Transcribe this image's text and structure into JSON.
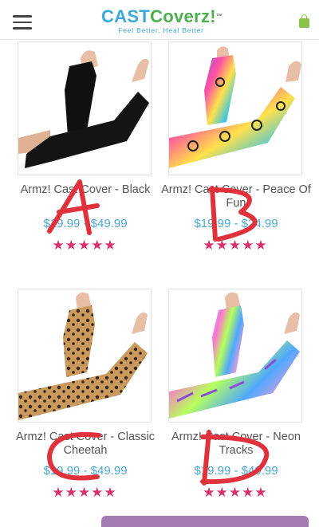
{
  "header": {
    "logo_cast": "CAST",
    "logo_coverz": "Coverz!",
    "logo_tm": "™",
    "tagline": "Feel Better, Heal Better"
  },
  "products": [
    {
      "title": "Armz! Cast Cover - Black",
      "price": "$19.99 - $49.99",
      "rating": 5,
      "stars": "★★★★★",
      "image": "black-arm-sleeves"
    },
    {
      "title": "Armz! Cast Cover - Peace Of Fun",
      "price": "$19.99 - $24.99",
      "rating": 5,
      "stars": "★★★★★",
      "image": "peace-pattern-arm-sleeves"
    },
    {
      "title": "Armz! Cast Cover - Classic Cheetah",
      "price": "$19.99 - $49.99",
      "rating": 5,
      "stars": "★★★★★",
      "image": "cheetah-arm-sleeves"
    },
    {
      "title": "Armz! Cast Cover - Neon Tracks",
      "price": "$19.99 - $49.99",
      "rating": 5,
      "stars": "★★★★★",
      "image": "neon-arm-sleeves"
    }
  ],
  "annotations": [
    "A",
    "B",
    "C",
    "D"
  ],
  "colors": {
    "accent_blue": "#4aa8d8",
    "star_pink": "#d6336c",
    "annotation_red": "#e0323c",
    "brand_green": "#4caf50"
  }
}
